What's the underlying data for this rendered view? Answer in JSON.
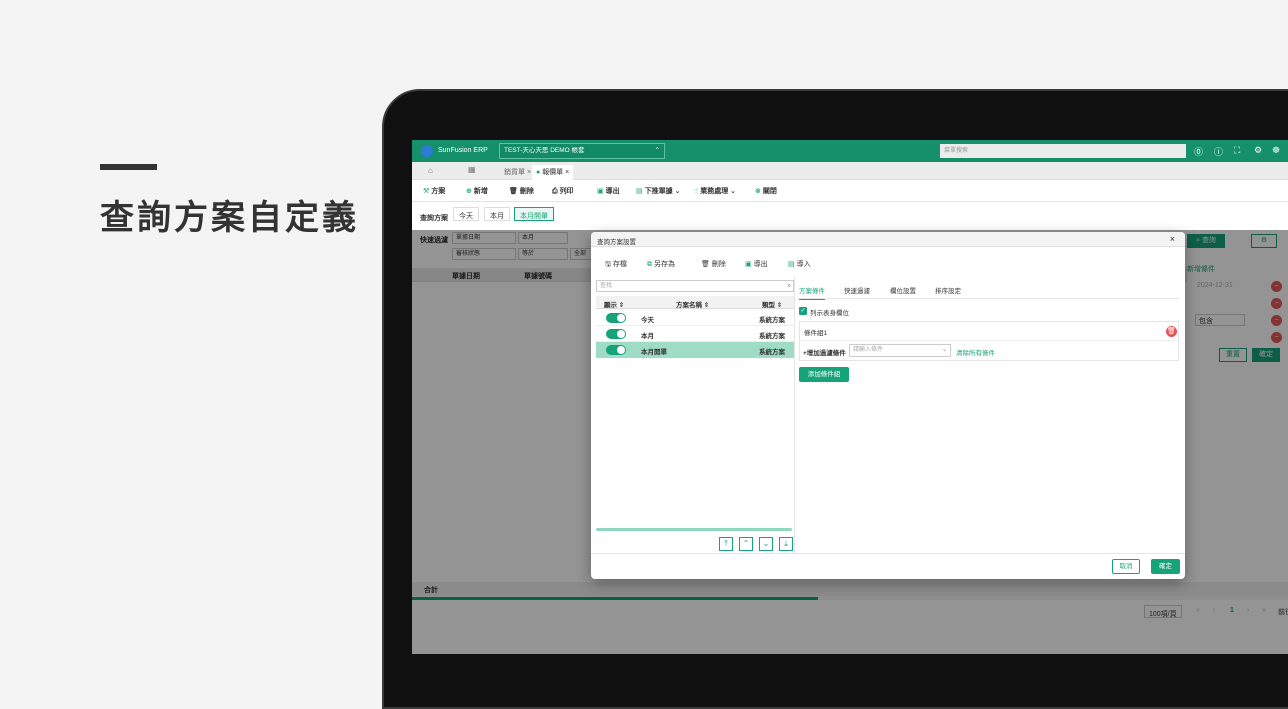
{
  "heading": "查詢方案自定義",
  "app": {
    "logo": "SunFusion ERP",
    "db": "TEST-天心天思 DEMO 帳套",
    "search_placeholder": "菜單搜索"
  },
  "tabs": [
    "銷貨單",
    "報價單"
  ],
  "toolbar": [
    "方案",
    "新增",
    "刪除",
    "列印",
    "導出",
    "下推單據",
    "業務處理",
    "關閉"
  ],
  "scheme_bar": {
    "label": "查詢方案",
    "items": [
      "今天",
      "本月",
      "本月開單"
    ]
  },
  "filter": {
    "label": "快速過濾",
    "field1": "單據日期",
    "op1": "本月",
    "field2": "審核狀態",
    "op2": "等於",
    "val2": "全部",
    "search": "查詢"
  },
  "grid": {
    "cols": [
      "單據日期",
      "單據號碼"
    ]
  },
  "right_panel": {
    "title": "新增條件",
    "date": "2024-12-31",
    "op": "包含",
    "reset": "重置",
    "ok": "確定"
  },
  "footer": {
    "total": "合計",
    "page_size": "100項/頁",
    "page": "1",
    "goto": "前往"
  },
  "dialog": {
    "title": "查詢方案設置",
    "actions": [
      "存檔",
      "另存為",
      "刪除",
      "導出",
      "導入"
    ],
    "search_placeholder": "查找",
    "cols": {
      "show": "顯示",
      "name": "方案名稱",
      "type": "類型"
    },
    "rows": [
      {
        "name": "今天",
        "type": "系統方案",
        "selected": false
      },
      {
        "name": "本月",
        "type": "系統方案",
        "selected": false
      },
      {
        "name": "本月開單",
        "type": "系統方案",
        "selected": true
      }
    ],
    "tabs": [
      "方案條件",
      "快速過濾",
      "欄位設置",
      "排序設定"
    ],
    "active_tab": 0,
    "checkbox_label": "列示表身欄位",
    "group_label": "條件組1",
    "add_cond": "+增加過濾條件",
    "cond_placeholder": "請輸入條件",
    "clear_all": "清除所有條件",
    "add_group": "添加條件組",
    "cancel": "取消",
    "confirm": "確定"
  },
  "colors": {
    "brand": "#15906a",
    "accent": "#17a37a"
  }
}
